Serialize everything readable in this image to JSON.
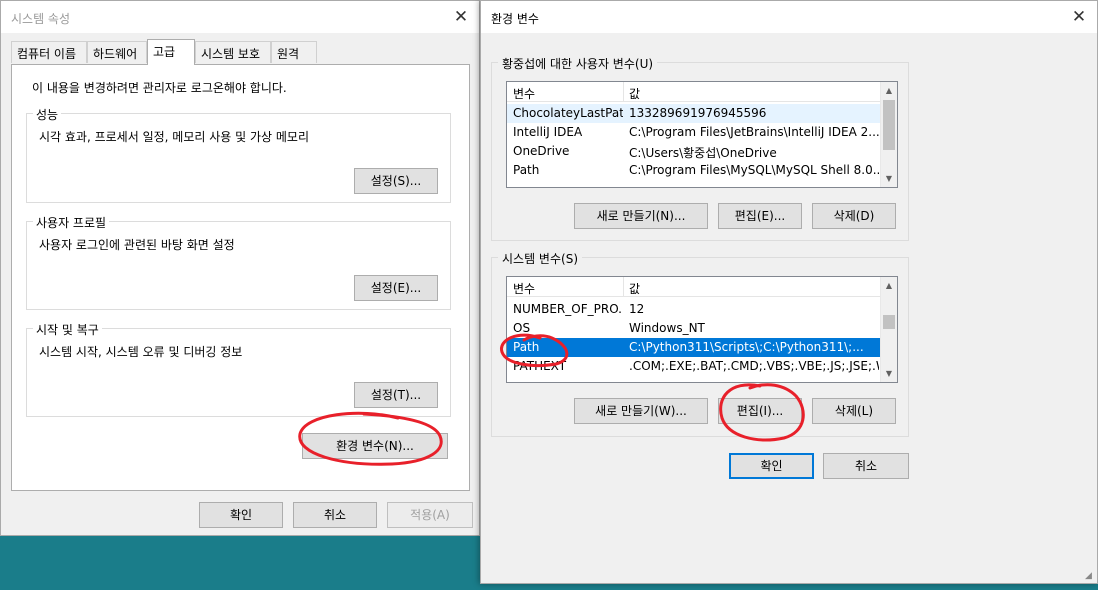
{
  "system_properties": {
    "title": "시스템 속성",
    "tabs": [
      "컴퓨터 이름",
      "하드웨어",
      "고급",
      "시스템 보호",
      "원격"
    ],
    "notice": "이 내용을 변경하려면 관리자로 로그온해야 합니다.",
    "performance": {
      "title": "성능",
      "desc": "시각 효과, 프로세서 일정, 메모리 사용 및 가상 메모리",
      "button": "설정(S)..."
    },
    "user_profile": {
      "title": "사용자 프로필",
      "desc": "사용자 로그인에 관련된 바탕 화면 설정",
      "button": "설정(E)..."
    },
    "startup": {
      "title": "시작 및 복구",
      "desc": "시스템 시작, 시스템 오류 및 디버깅 정보",
      "button": "설정(T)..."
    },
    "env_button": "환경 변수(N)...",
    "footer": {
      "ok": "확인",
      "cancel": "취소",
      "apply": "적용(A)"
    }
  },
  "env_vars": {
    "title": "환경 변수",
    "user_group_title": "황중섭에 대한 사용자 변수(U)",
    "columns": {
      "var": "변수",
      "value": "값"
    },
    "user_rows": [
      {
        "var": "ChocolateyLastPat...",
        "value": "133289691976945596"
      },
      {
        "var": "IntelliJ IDEA",
        "value": "C:\\Program Files\\JetBrains\\IntelliJ IDEA 2..."
      },
      {
        "var": "OneDrive",
        "value": "C:\\Users\\황중섭\\OneDrive"
      },
      {
        "var": "Path",
        "value": "C:\\Program Files\\MySQL\\MySQL Shell 8.0..."
      }
    ],
    "user_buttons": {
      "new": "새로 만들기(N)...",
      "edit": "편집(E)...",
      "delete": "삭제(D)"
    },
    "system_group_title": "시스템 변수(S)",
    "system_rows": [
      {
        "var": "NUMBER_OF_PRO...",
        "value": "12"
      },
      {
        "var": "OS",
        "value": "Windows_NT"
      },
      {
        "var": "Path",
        "value": "C:\\Python311\\Scripts\\;C:\\Python311\\;..."
      },
      {
        "var": "PATHEXT",
        "value": ".COM;.EXE;.BAT;.CMD;.VBS;.VBE;.JS;.JSE;.W..."
      }
    ],
    "system_buttons": {
      "new": "새로 만들기(W)...",
      "edit": "편집(I)...",
      "delete": "삭제(L)"
    },
    "footer": {
      "ok": "확인",
      "cancel": "취소"
    }
  },
  "icons": {
    "close": "close-icon",
    "scroll_up": "scroll-up-icon",
    "scroll_down": "scroll-down-icon"
  },
  "colors": {
    "selection": "#0078d7",
    "annotation": "#e8202a",
    "desktop": "#1a7d8a"
  }
}
